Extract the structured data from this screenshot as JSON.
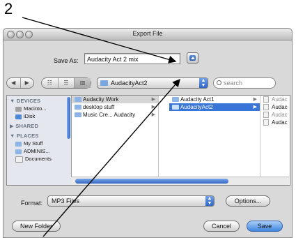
{
  "annotation": {
    "number": "2"
  },
  "window": {
    "title": "Export File"
  },
  "save_as": {
    "label": "Save As:",
    "value": "Audacity Act 2 mix"
  },
  "toolbar": {
    "back_label": "◀",
    "forward_label": "▶",
    "view_icon_label": "☷",
    "view_list_label": "☰",
    "view_column_label": "▥",
    "location": "AudacityAct2",
    "search_placeholder": "search"
  },
  "sidebar": {
    "devices_header": "▼ DEVICES",
    "devices": [
      "Macinto...",
      "iDisk"
    ],
    "shared_header": "▶ SHARED",
    "places_header": "▼ PLACES",
    "places": [
      "My Stuff",
      "ADMINIS...",
      "Documents"
    ]
  },
  "columns": [
    {
      "rows": [
        {
          "label": "Audacity Work",
          "state": "grey"
        },
        {
          "label": "desktop stuff",
          "state": ""
        },
        {
          "label": "Music Cre... Audacity",
          "state": ""
        }
      ]
    },
    {
      "rows": [
        {
          "label": "Audacity Act1",
          "state": ""
        },
        {
          "label": "AudacityAct2",
          "state": "sel"
        }
      ]
    },
    {
      "rows": [
        {
          "label": "Audac"
        },
        {
          "label": "Audac"
        },
        {
          "label": "Audac"
        },
        {
          "label": "Audac"
        }
      ]
    }
  ],
  "format": {
    "label": "Format:",
    "value": "MP3 Files"
  },
  "buttons": {
    "options": "Options...",
    "new_folder": "New Folder",
    "cancel": "Cancel",
    "save": "Save"
  },
  "colors": {
    "selection": "#3875d7",
    "sidebar_bg": "#e4e8ee",
    "default_button": "#3f86e0"
  }
}
